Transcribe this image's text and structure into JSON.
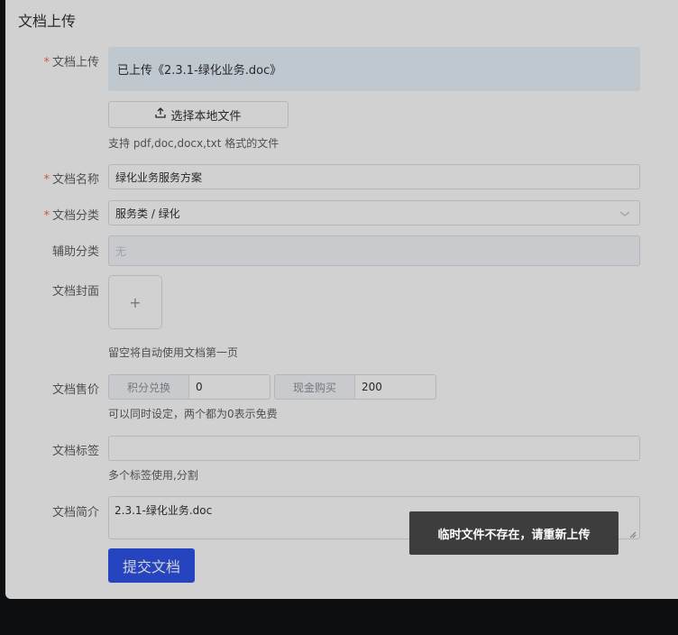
{
  "panel_title": "文档上传",
  "upload": {
    "label": "文档上传",
    "status": "已上传《2.3.1-绿化业务.doc》",
    "choose_button": "选择本地文件",
    "hint": "支持 pdf,doc,docx,txt 格式的文件",
    "icon": "upload-icon"
  },
  "name": {
    "label": "文档名称",
    "value": "绿化业务服务方案"
  },
  "category": {
    "label": "文档分类",
    "value": "服务类 / 绿化",
    "icon": "chevron-down-icon"
  },
  "aux_category": {
    "label": "辅助分类",
    "placeholder": "无"
  },
  "cover": {
    "label": "文档封面",
    "plus": "+",
    "hint": "留空将自动使用文档第一页"
  },
  "price": {
    "label": "文档售价",
    "points_prefix": "积分兑换",
    "points_value": "0",
    "cash_prefix": "现金购买",
    "cash_value": "200",
    "hint": "可以同时设定，两个都为0表示免费"
  },
  "tags": {
    "label": "文档标签",
    "value": "",
    "hint": "多个标签使用,分割"
  },
  "intro": {
    "label": "文档简介",
    "value": "2.3.1-绿化业务.doc"
  },
  "submit": {
    "label": "提交文档",
    "color": "#2f54eb"
  },
  "toast": {
    "message": "临时文件不存在，请重新上传"
  },
  "colors": {
    "required": "#f56c6c",
    "upload_success_bg": "#eaf3fd",
    "bottom_bar": "#111214"
  }
}
